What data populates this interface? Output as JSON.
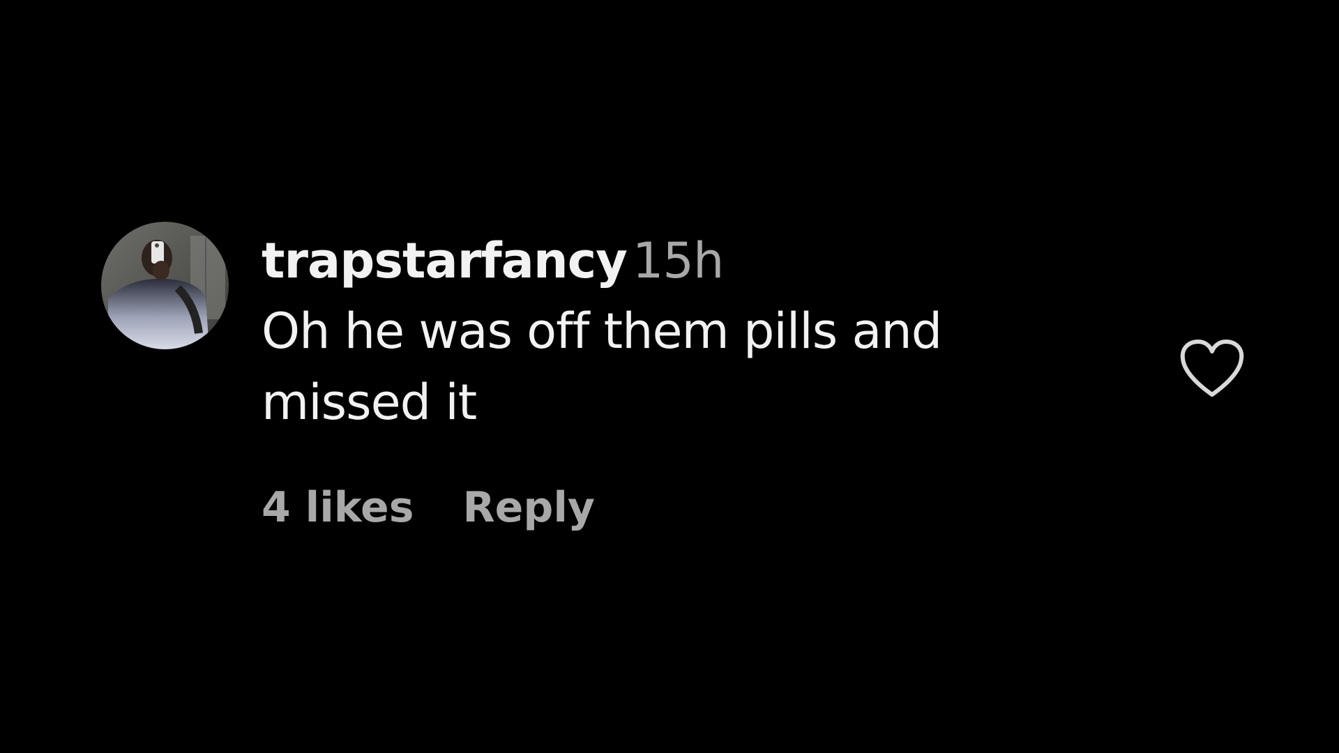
{
  "comment": {
    "username": "trapstarfancy",
    "timestamp": "15h",
    "text": "Oh he was off them pills and missed it",
    "likes_label": "4 likes",
    "reply_label": "Reply"
  },
  "icons": {
    "like": "heart-outline-icon",
    "avatar": "profile-photo"
  },
  "colors": {
    "background": "#000000",
    "primary_text": "#f2f2f2",
    "secondary_text": "#a8a8a8",
    "icon_stroke": "#d9d9d9"
  }
}
